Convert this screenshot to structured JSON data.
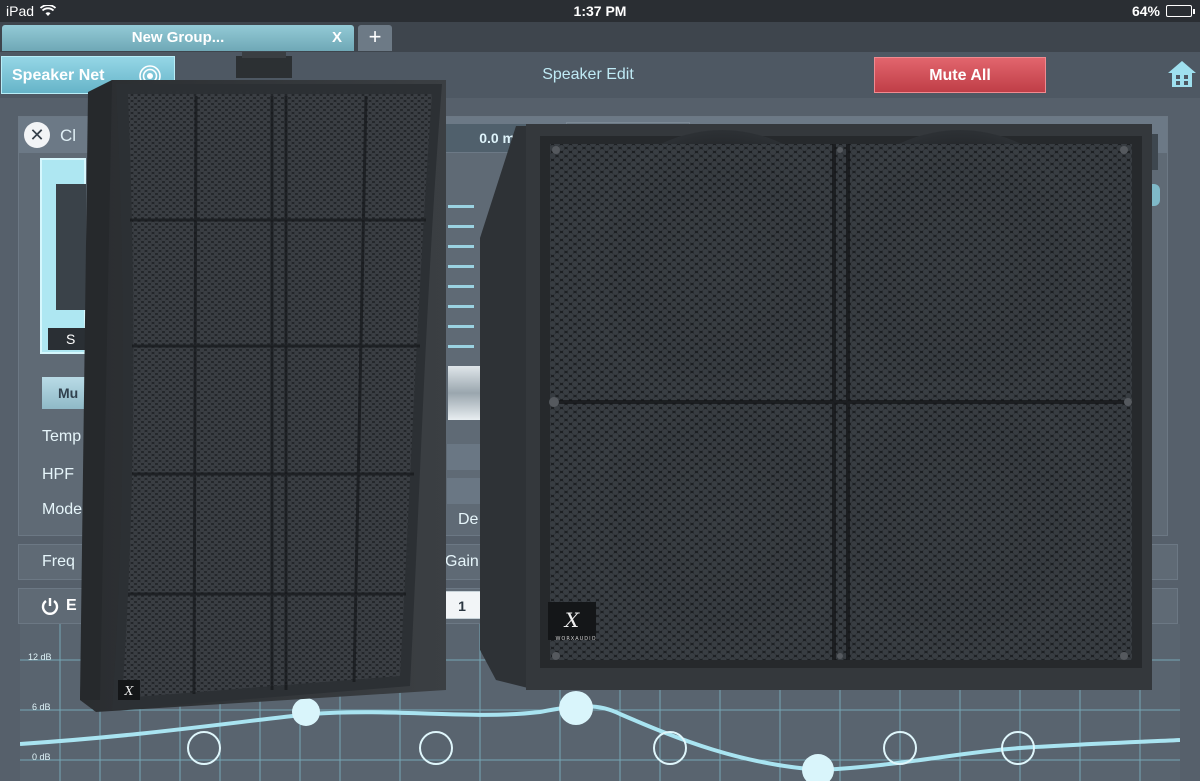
{
  "status_bar": {
    "device": "iPad",
    "time": "1:37 PM",
    "battery": "64%",
    "battery_level": 0.64
  },
  "tabs": [
    {
      "label": "New Group...",
      "close": "X"
    }
  ],
  "add_tab": "+",
  "toolbar": {
    "speaker_net": "Speaker Net",
    "title": "Speaker Edit",
    "mute_all": "Mute All"
  },
  "panel": {
    "close": "✕",
    "title": "Cl",
    "delay": "0.0 ms",
    "thumb_label": "S",
    "mute": "Mu",
    "labels": {
      "temp": "Temp",
      "hpf": "HPF",
      "mode": "Mode",
      "de": "De"
    }
  },
  "controls": {
    "freq": "Freq",
    "gain": "Gain"
  },
  "eq": {
    "label": "E",
    "band": "1",
    "db_labels": [
      "12 dB",
      "6 dB",
      "0 dB"
    ]
  },
  "speakers": {
    "left_logo": "X",
    "right_logo": "X",
    "right_brand": "WORXAUDIO"
  },
  "colors": {
    "accent": "#8fd0e0",
    "mute_red": "#d04c55",
    "panel": "#5f6a75"
  },
  "icons": [
    "wifi-icon",
    "battery-icon",
    "speaker-net-wave-icon",
    "home-icon",
    "close-icon",
    "power-icon"
  ]
}
